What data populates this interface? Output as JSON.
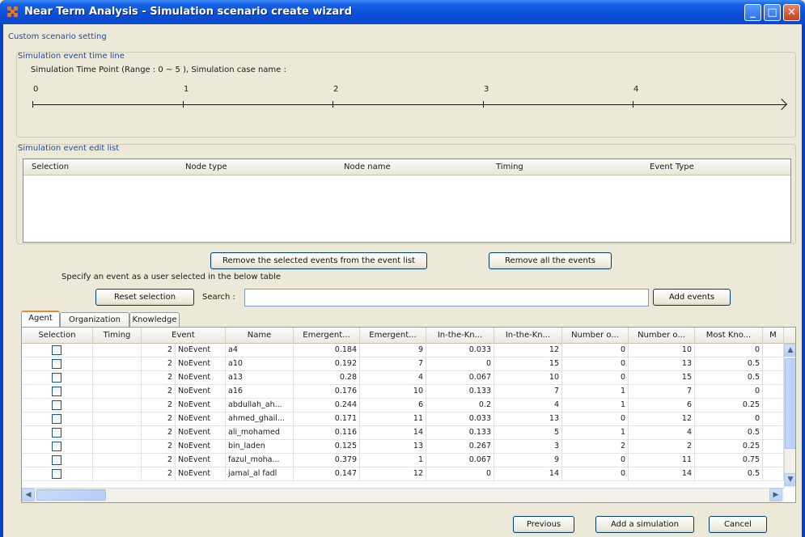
{
  "window": {
    "title": "Near Term Analysis - Simulation scenario create wizard",
    "controls": {
      "minimize": "_",
      "maximize": "□",
      "close": "✕"
    }
  },
  "custom_setting_label": "Custom scenario setting",
  "timeline": {
    "group_label": "Simulation event time line",
    "caption": "Simulation Time Point (Range : 0 ~ 5 ), Simulation case name :",
    "points": [
      "0",
      "1",
      "2",
      "3",
      "4"
    ]
  },
  "event_list": {
    "group_label": "Simulation event edit list",
    "columns": [
      "Selection",
      "Node type",
      "Node name",
      "Timing",
      "Event Type"
    ]
  },
  "buttons": {
    "remove_selected": "Remove the selected events from the event list",
    "remove_all": "Remove all the events",
    "reset_selection": "Reset selection",
    "add_events": "Add events",
    "previous": "Previous",
    "add_simulation": "Add a simulation",
    "cancel": "Cancel"
  },
  "instruction": "Specify an event as a user selected in the below table",
  "search": {
    "label": "Search :",
    "value": ""
  },
  "tabs": [
    "Agent",
    "Organization",
    "Knowledge"
  ],
  "agent_table": {
    "columns": [
      "Selection",
      "Timing",
      "Event",
      "Name",
      "Emergent...",
      "Emergent...",
      "In-the-Kn...",
      "In-the-Kn...",
      "Number o...",
      "Number o...",
      "Most Kno...",
      "M"
    ],
    "rows": [
      {
        "timing": "",
        "event_num": "2",
        "event": "NoEvent",
        "name": "a4",
        "v1": "0.184",
        "v2": "9",
        "v3": "0.033",
        "v4": "12",
        "v5": "0",
        "v6": "10",
        "v7": "0"
      },
      {
        "timing": "",
        "event_num": "2",
        "event": "NoEvent",
        "name": "a10",
        "v1": "0.192",
        "v2": "7",
        "v3": "0",
        "v4": "15",
        "v5": "0",
        "v6": "13",
        "v7": "0.5"
      },
      {
        "timing": "",
        "event_num": "2",
        "event": "NoEvent",
        "name": "a13",
        "v1": "0.28",
        "v2": "4",
        "v3": "0.067",
        "v4": "10",
        "v5": "0",
        "v6": "15",
        "v7": "0.5"
      },
      {
        "timing": "",
        "event_num": "2",
        "event": "NoEvent",
        "name": "a16",
        "v1": "0.176",
        "v2": "10",
        "v3": "0.133",
        "v4": "7",
        "v5": "1",
        "v6": "7",
        "v7": "0"
      },
      {
        "timing": "",
        "event_num": "2",
        "event": "NoEvent",
        "name": "abdullah_ah...",
        "v1": "0.244",
        "v2": "6",
        "v3": "0.2",
        "v4": "4",
        "v5": "1",
        "v6": "6",
        "v7": "0.25"
      },
      {
        "timing": "",
        "event_num": "2",
        "event": "NoEvent",
        "name": "ahmed_ghail...",
        "v1": "0.171",
        "v2": "11",
        "v3": "0.033",
        "v4": "13",
        "v5": "0",
        "v6": "12",
        "v7": "0"
      },
      {
        "timing": "",
        "event_num": "2",
        "event": "NoEvent",
        "name": "ali_mohamed",
        "v1": "0.116",
        "v2": "14",
        "v3": "0.133",
        "v4": "5",
        "v5": "1",
        "v6": "4",
        "v7": "0.5"
      },
      {
        "timing": "",
        "event_num": "2",
        "event": "NoEvent",
        "name": "bin_laden",
        "v1": "0.125",
        "v2": "13",
        "v3": "0.267",
        "v4": "3",
        "v5": "2",
        "v6": "2",
        "v7": "0.25"
      },
      {
        "timing": "",
        "event_num": "2",
        "event": "NoEvent",
        "name": "fazul_moha...",
        "v1": "0.379",
        "v2": "1",
        "v3": "0.067",
        "v4": "9",
        "v5": "0",
        "v6": "11",
        "v7": "0.75"
      },
      {
        "timing": "",
        "event_num": "2",
        "event": "NoEvent",
        "name": "jamal_al fadl",
        "v1": "0.147",
        "v2": "12",
        "v3": "0",
        "v4": "14",
        "v5": "0",
        "v6": "14",
        "v7": "0.5"
      }
    ]
  },
  "scroll": {
    "up": "▲",
    "down": "▼",
    "left": "◀",
    "right": "▶"
  },
  "colors": {
    "title_bar": "#0c4fd8",
    "group_label": "#1e4aa8",
    "tab_accent": "#e68b2c"
  }
}
